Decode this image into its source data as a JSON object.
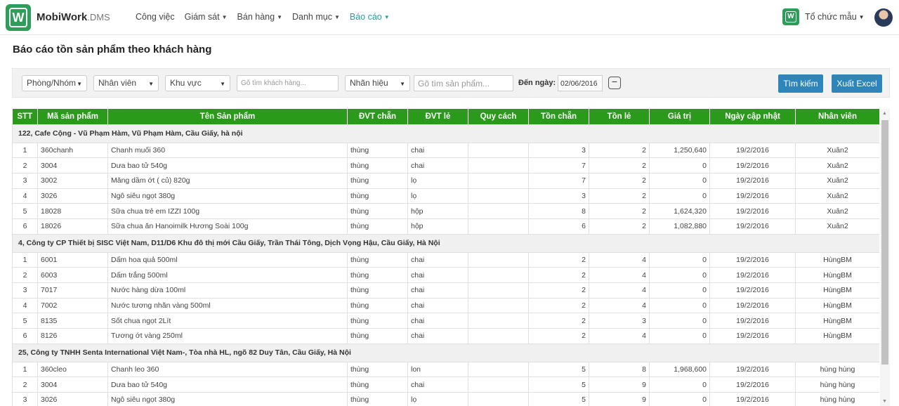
{
  "brand": {
    "name": "MobiWork",
    "suffix": ".DMS",
    "logo_letter": "W"
  },
  "nav": [
    {
      "label": "Công việc",
      "dropdown": false,
      "active": false
    },
    {
      "label": "Giám sát",
      "dropdown": true,
      "active": false
    },
    {
      "label": "Bán hàng",
      "dropdown": true,
      "active": false
    },
    {
      "label": "Danh mục",
      "dropdown": true,
      "active": false
    },
    {
      "label": "Báo cáo",
      "dropdown": true,
      "active": true
    }
  ],
  "org": {
    "name": "Tổ chức mẫu"
  },
  "page_title": "Báo cáo tồn sản phẩm theo khách hàng",
  "filters": {
    "department": "Phòng/Nhóm",
    "staff": "Nhân viên",
    "region": "Khu vực",
    "customer_placeholder": "Gõ tìm khách hàng...",
    "brand": "Nhãn hiệu",
    "product_placeholder": "Gõ tìm sản phẩm...",
    "date_label": "Đến ngày:",
    "date_value": "02/06/2016",
    "search_label": "Tìm kiếm",
    "export_label": "Xuất Excel"
  },
  "table": {
    "headers": [
      "STT",
      "Mã sản phẩm",
      "Tên Sản phẩm",
      "ĐVT chẵn",
      "ĐVT lẻ",
      "Quy cách",
      "Tồn chẵn",
      "Tồn lẻ",
      "Giá trị",
      "Ngày cập nhật",
      "Nhân viên"
    ],
    "groups": [
      {
        "title": "122, Cafe Cộng - Vũ Phạm Hàm, Vũ Phạm Hàm, Cầu Giấy, hà nội",
        "rows": [
          [
            "1",
            "360chanh",
            "Chanh muối 360",
            "thùng",
            "chai",
            "",
            "3",
            "2",
            "1,250,640",
            "19/2/2016",
            "Xuân2"
          ],
          [
            "2",
            "3004",
            "Dưa bao tử 540g",
            "thùng",
            "chai",
            "",
            "7",
            "2",
            "0",
            "19/2/2016",
            "Xuân2"
          ],
          [
            "3",
            "3002",
            "Măng dầm ớt ( củ) 820g",
            "thùng",
            "lọ",
            "",
            "7",
            "2",
            "0",
            "19/2/2016",
            "Xuân2"
          ],
          [
            "4",
            "3026",
            "Ngô siêu ngọt 380g",
            "thùng",
            "lọ",
            "",
            "3",
            "2",
            "0",
            "19/2/2016",
            "Xuân2"
          ],
          [
            "5",
            "18028",
            "Sữa chua trẻ em IZZI 100g",
            "thùng",
            "hộp",
            "",
            "8",
            "2",
            "1,624,320",
            "19/2/2016",
            "Xuân2"
          ],
          [
            "6",
            "18026",
            "Sữa chua ăn Hanoimilk Hương Soài 100g",
            "thùng",
            "hộp",
            "",
            "6",
            "2",
            "1,082,880",
            "19/2/2016",
            "Xuân2"
          ]
        ]
      },
      {
        "title": "4, Công ty CP Thiết bị SISC Việt Nam, D11/D6 Khu đô thị mới Cầu Giấy, Trần Thái Tông, Dịch Vọng Hậu, Cầu Giấy, Hà Nội",
        "rows": [
          [
            "1",
            "6001",
            "Dấm hoa quả 500ml",
            "thùng",
            "chai",
            "",
            "2",
            "4",
            "0",
            "19/2/2016",
            "HùngBM"
          ],
          [
            "2",
            "6003",
            "Dấm trắng 500ml",
            "thùng",
            "chai",
            "",
            "2",
            "4",
            "0",
            "19/2/2016",
            "HùngBM"
          ],
          [
            "3",
            "7017",
            "Nước hàng dừa 100ml",
            "thùng",
            "chai",
            "",
            "2",
            "4",
            "0",
            "19/2/2016",
            "HùngBM"
          ],
          [
            "4",
            "7002",
            "Nước tương nhãn vàng 500ml",
            "thùng",
            "chai",
            "",
            "2",
            "4",
            "0",
            "19/2/2016",
            "HùngBM"
          ],
          [
            "5",
            "8135",
            "Sốt chua ngọt 2Lít",
            "thùng",
            "chai",
            "",
            "2",
            "3",
            "0",
            "19/2/2016",
            "HùngBM"
          ],
          [
            "6",
            "8126",
            "Tương ớt vàng 250ml",
            "thùng",
            "chai",
            "",
            "2",
            "4",
            "0",
            "19/2/2016",
            "HùngBM"
          ]
        ]
      },
      {
        "title": "25, Công ty TNHH Senta International Việt Nam-, Tòa nhà HL, ngõ 82 Duy Tân, Cầu Giấy, Hà Nội",
        "rows": [
          [
            "1",
            "360cleo",
            "Chanh leo 360",
            "thùng",
            "lon",
            "",
            "5",
            "8",
            "1,968,600",
            "19/2/2016",
            "hùng hùng"
          ],
          [
            "2",
            "3004",
            "Dưa bao tử 540g",
            "thùng",
            "chai",
            "",
            "5",
            "9",
            "0",
            "19/2/2016",
            "hùng hùng"
          ],
          [
            "3",
            "3026",
            "Ngô siêu ngọt 380g",
            "thùng",
            "lọ",
            "",
            "5",
            "9",
            "0",
            "19/2/2016",
            "hùng hùng"
          ]
        ]
      }
    ]
  }
}
